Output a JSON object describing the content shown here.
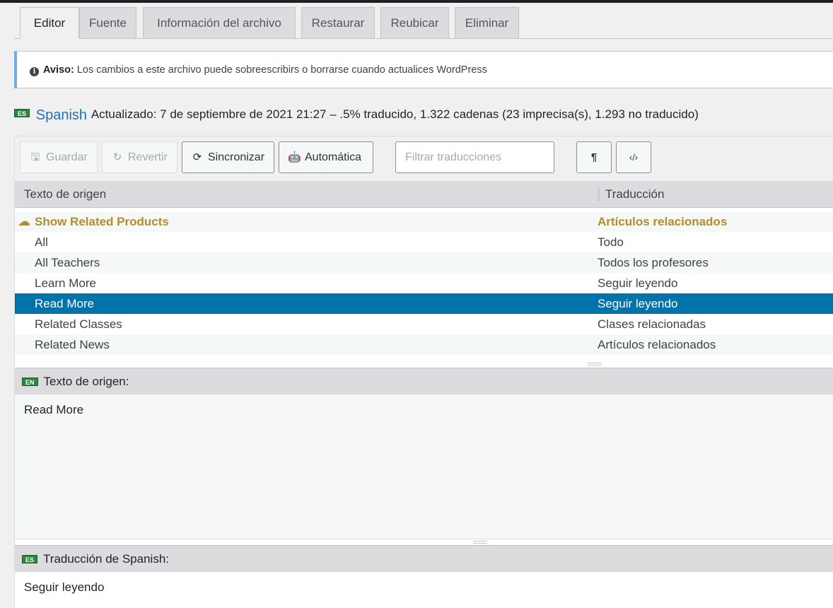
{
  "tabs": [
    {
      "label": "Editor"
    },
    {
      "label": "Fuente"
    },
    {
      "label": "Información del archivo"
    },
    {
      "label": "Restaurar"
    },
    {
      "label": "Reubicar"
    },
    {
      "label": "Eliminar"
    }
  ],
  "notice": {
    "prefix": "Aviso:",
    "text": "Los cambios a este archivo puede sobreescribirs o borrarse cuando actualices WordPress"
  },
  "meta": {
    "flag": "ES",
    "language": "Spanish",
    "status": "Actualizado: 7 de septiembre de 2021 21:27 – .5% traducido, 1.322 cadenas (23 imprecisa(s), 1.293 no traducido)"
  },
  "toolbar": {
    "save": "Guardar",
    "revert": "Revertir",
    "sync": "Sincronizar",
    "auto": "Automática",
    "filter_placeholder": "Filtrar traducciones",
    "pilcrow": "¶",
    "code": "‹/›"
  },
  "table": {
    "col_source": "Texto de origen",
    "col_translation": "Traducción",
    "rows": [
      {
        "source": "Show Related Products",
        "translation": "Artículos relacionados"
      },
      {
        "source": "All",
        "translation": "Todo"
      },
      {
        "source": "All Teachers",
        "translation": "Todos los profesores"
      },
      {
        "source": "Learn More",
        "translation": "Seguir leyendo"
      },
      {
        "source": "Read More",
        "translation": "Seguir leyendo"
      },
      {
        "source": "Related Classes",
        "translation": "Clases relacionadas"
      },
      {
        "source": "Related News",
        "translation": "Artículos relacionados"
      }
    ]
  },
  "source_panel": {
    "flag": "EN",
    "label": "Texto de origen:",
    "value": "Read More"
  },
  "translation_panel": {
    "flag": "ES",
    "label": "Traducción de Spanish:",
    "value": "Seguir leyendo"
  },
  "colors": {
    "selected_row": "#0073aa",
    "group_row_text": "#b08d2e",
    "notice_border": "#72aee6",
    "flag_green": "#2e8540"
  }
}
